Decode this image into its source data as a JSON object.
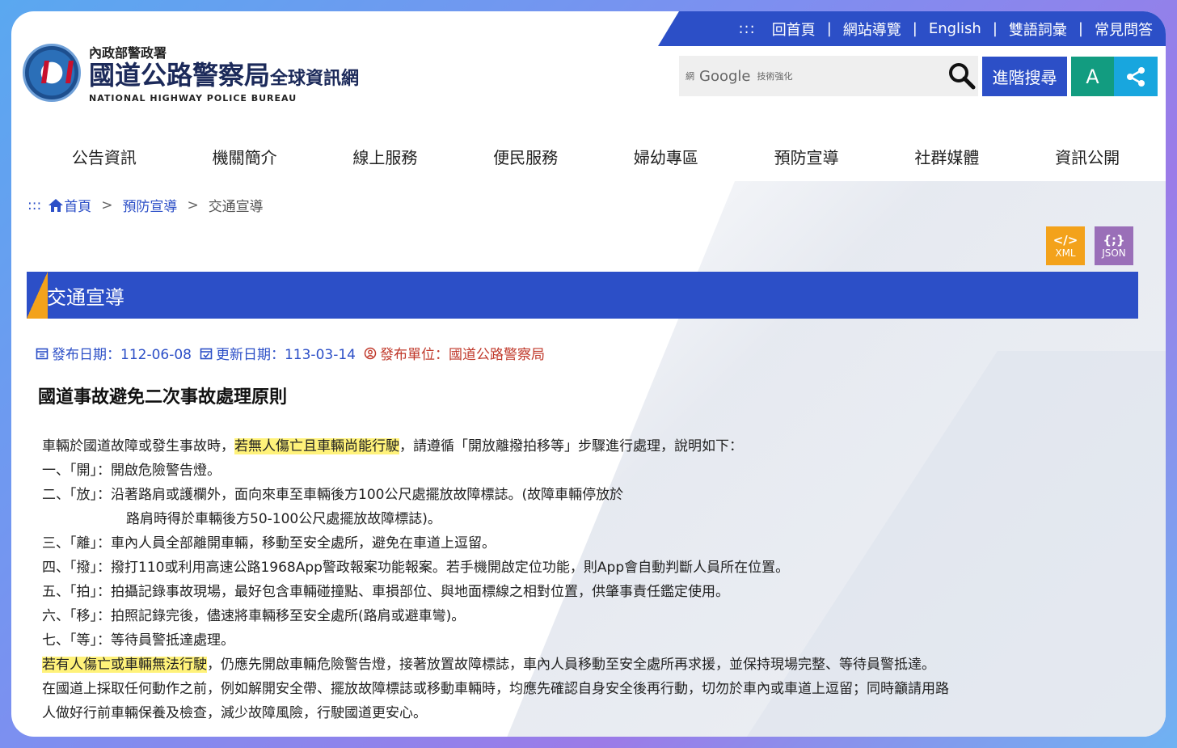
{
  "topbar": {
    "accessibility": ":::",
    "links": [
      "回首頁",
      "網站導覽",
      "English",
      "雙語詞彙",
      "常見問答"
    ]
  },
  "logo": {
    "subtitle": "內政部警政署",
    "main": "國道公路警察局",
    "suffix": "全球資訊網",
    "english": "NATIONAL HIGHWAY POLICE BUREAU"
  },
  "search": {
    "google_prefix": "網",
    "google_brand": "Google",
    "google_powered": "技術強化",
    "advanced_label": "進階搜尋",
    "font_label": "A"
  },
  "nav": [
    "公告資訊",
    "機關簡介",
    "線上服務",
    "便民服務",
    "婦幼專區",
    "預防宣導",
    "社群媒體",
    "資訊公開"
  ],
  "breadcrumb": {
    "dots": ":::",
    "home": "首頁",
    "level1": "預防宣導",
    "current": "交通宣導",
    "sep": ">"
  },
  "badges": {
    "xml_icon": "</>",
    "xml_label": "XML",
    "json_icon": "{;}",
    "json_label": "JSON"
  },
  "section_title": "交通宣導",
  "meta": {
    "publish": "發布日期：112-06-08",
    "update": "更新日期：113-03-14",
    "unit": "發布單位：國道公路警察局"
  },
  "article": {
    "title": "國道事故避免二次事故處理原則",
    "intro_a": "車輛於國道故障或發生事故時，",
    "intro_hl": "若無人傷亡且車輛尚能行駛",
    "intro_b": "，請遵循「開放離撥拍移等」步驟進行處理，說明如下：",
    "step1": "一、「開」：開啟危險警告燈。",
    "step2": "二、「放」：沿著路肩或護欄外，面向來車至車輛後方100公尺處擺放故障標誌。(故障車輛停放於",
    "step2b": "路肩時得於車輛後方50-100公尺處擺放故障標誌)。",
    "step3": "三、「離」：車內人員全部離開車輛，移動至安全處所，避免在車道上逗留。",
    "step4": "四、「撥」：撥打110或利用高速公路1968App警政報案功能報案。若手機開啟定位功能，則App會自動判斷人員所在位置。",
    "step5": "五、「拍」：拍攝記錄事故現場，最好包含車輛碰撞點、車損部位、與地面標線之相對位置，供肇事責任鑑定使用。",
    "step6": "六、「移」：拍照記錄完後，儘速將車輛移至安全處所(路肩或避車彎)。",
    "step7": "七、「等」：等待員警抵達處理。",
    "injury_hl": "若有人傷亡或車輛無法行駛",
    "injury_b": "，仍應先開啟車輛危險警告燈，接著放置故障標誌，車內人員移動至安全處所再求援，並保持現場完整、等待員警抵達。",
    "closing1": "在國道上採取任何動作之前，例如解開安全帶、擺放故障標誌或移動車輛時，均應先確認自身安全後再行動，切勿於車內或車道上逗留；同時籲請用路",
    "closing2": "人做好行前車輛保養及檢查，減少故障風險，行駛國道更安心。"
  }
}
